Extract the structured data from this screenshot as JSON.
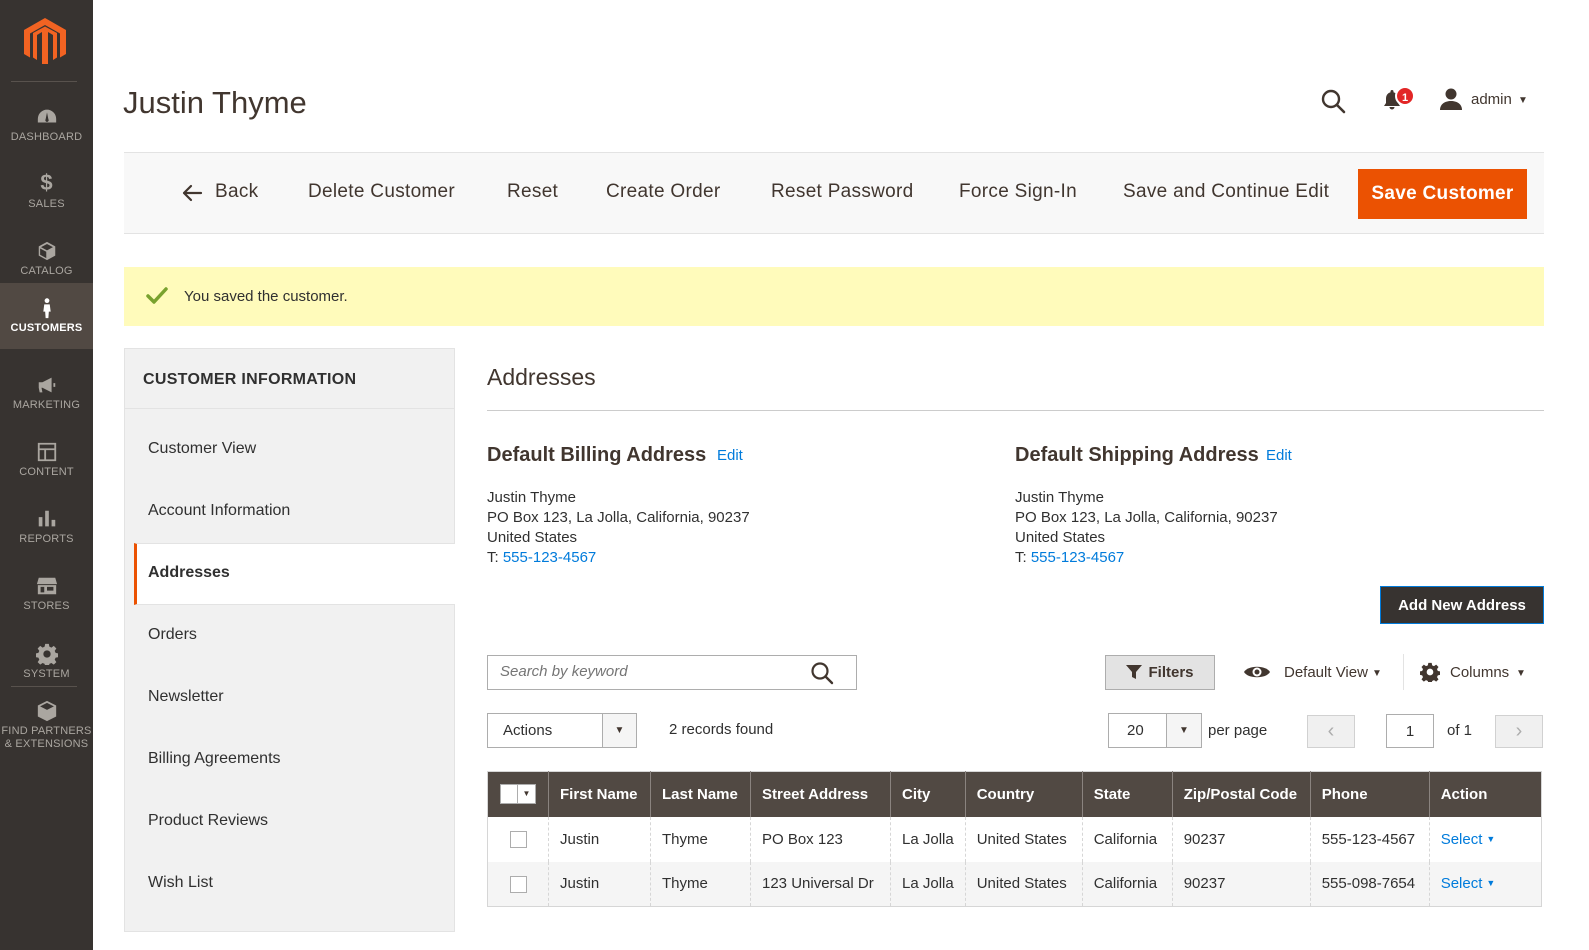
{
  "colors": {
    "accent": "#eb5202",
    "sidebar": "#373330",
    "link": "#007bdb",
    "message_bg": "#fffbbb",
    "grid_header": "#514943"
  },
  "sidebar": {
    "logo": "magento-logo-icon",
    "items": [
      {
        "label": "DASHBOARD",
        "icon": "dashboard-icon"
      },
      {
        "label": "SALES",
        "icon": "dollar-icon"
      },
      {
        "label": "CATALOG",
        "icon": "cube-icon"
      },
      {
        "label": "CUSTOMERS",
        "icon": "person-icon",
        "active": true
      },
      {
        "label": "MARKETING",
        "icon": "megaphone-icon"
      },
      {
        "label": "CONTENT",
        "icon": "layout-icon"
      },
      {
        "label": "REPORTS",
        "icon": "bar-chart-icon"
      },
      {
        "label": "STORES",
        "icon": "store-icon"
      },
      {
        "label": "SYSTEM",
        "icon": "gear-icon"
      }
    ],
    "partners": {
      "line1": "FIND PARTNERS",
      "line2": "& EXTENSIONS",
      "icon": "box-icon"
    }
  },
  "header": {
    "title": "Justin Thyme",
    "notifications_count": "1",
    "user": "admin"
  },
  "toolbar": {
    "back": "Back",
    "delete": "Delete Customer",
    "reset": "Reset",
    "create_order": "Create Order",
    "reset_password": "Reset Password",
    "force_signin": "Force Sign-In",
    "save_continue": "Save and Continue Edit",
    "save": "Save Customer"
  },
  "message": {
    "text": "You saved the customer."
  },
  "tabs": {
    "title": "CUSTOMER INFORMATION",
    "items": [
      {
        "label": "Customer View"
      },
      {
        "label": "Account Information"
      },
      {
        "label": "Addresses",
        "active": true
      },
      {
        "label": "Orders"
      },
      {
        "label": "Newsletter"
      },
      {
        "label": "Billing Agreements"
      },
      {
        "label": "Product Reviews"
      },
      {
        "label": "Wish List"
      }
    ]
  },
  "addresses": {
    "title": "Addresses",
    "edit_label": "Edit",
    "billing": {
      "heading": "Default Billing Address",
      "name": "Justin Thyme",
      "street": "PO Box 123, La Jolla, California, 90237",
      "country": "United States",
      "phone_prefix": "T: ",
      "phone": "555-123-4567"
    },
    "shipping": {
      "heading": "Default Shipping Address",
      "name": "Justin Thyme",
      "street": "PO Box 123, La Jolla, California, 90237",
      "country": "United States",
      "phone_prefix": "T: ",
      "phone": "555-123-4567"
    },
    "add_new": "Add New Address"
  },
  "grid_controls": {
    "search_placeholder": "Search by keyword",
    "filters": "Filters",
    "view": "Default View",
    "columns": "Columns",
    "actions": "Actions",
    "records_found": "2 records found",
    "per_page_value": "20",
    "per_page_label": "per page",
    "page_value": "1",
    "page_of": "of 1"
  },
  "grid": {
    "columns": [
      "First Name",
      "Last Name",
      "Street Address",
      "City",
      "Country",
      "State",
      "Zip/Postal Code",
      "Phone",
      "Action"
    ],
    "rows": [
      [
        "Justin",
        "Thyme",
        "PO Box 123",
        "La Jolla",
        "United States",
        "California",
        "90237",
        "555-123-4567",
        "Select"
      ],
      [
        "Justin",
        "Thyme",
        "123 Universal Dr",
        "La Jolla",
        "United States",
        "California",
        "90237",
        "555-098-7654",
        "Select"
      ]
    ]
  }
}
